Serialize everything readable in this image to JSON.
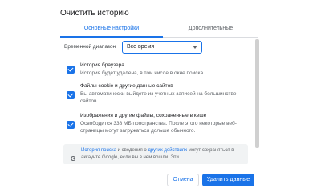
{
  "dialog": {
    "title": "Очистить историю"
  },
  "tabs": [
    {
      "label": "Основные настройки",
      "active": true
    },
    {
      "label": "Дополнительные",
      "active": false
    }
  ],
  "time_range": {
    "label": "Временной диапазон",
    "value": "Все время"
  },
  "options": [
    {
      "title": "История браузера",
      "description": "История будет удалена, в том числе в окне поиска",
      "checked": true
    },
    {
      "title": "Файлы cookie и другие данные сайтов",
      "description": "Вы автоматически выйдете из учетных записей на большинстве сайтов.",
      "checked": true
    },
    {
      "title": "Изображения и другие файлы, сохраненные в кеше",
      "description": "Освободится 338 МБ пространства. После этого некоторые веб-страницы могут загружаться дольше обычного.",
      "checked": true
    }
  ],
  "info": {
    "link1": "История поиска",
    "text1": " и сведения о ",
    "link2": "других действиях",
    "text2": " могут сохраняться в аккаунте Google, если вы в нем вошли. Эти",
    "icon": "google-g-icon"
  },
  "buttons": {
    "cancel": "Отмена",
    "delete": "Удалить данные"
  },
  "colors": {
    "accent": "#1a73e8",
    "text": "#202124",
    "secondary": "#5f6368"
  }
}
